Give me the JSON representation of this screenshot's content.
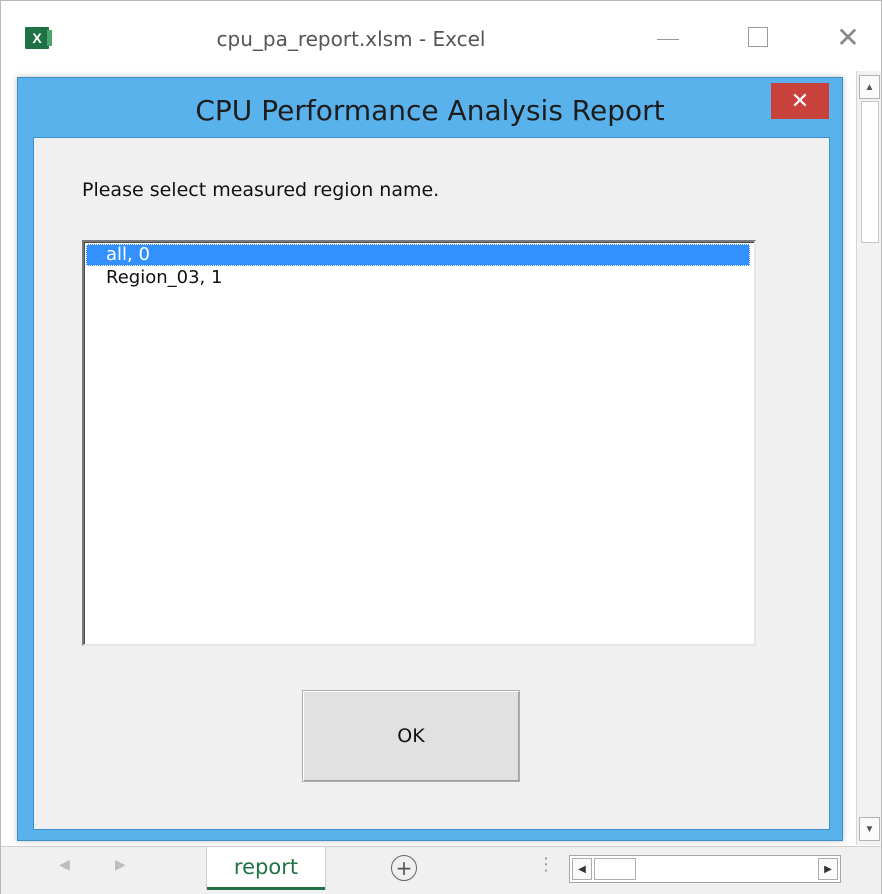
{
  "window": {
    "title": "cpu_pa_report.xlsm - Excel",
    "app_icon_letter": "X",
    "minimize_icon": "minimize-icon",
    "maximize_icon": "maximize-icon",
    "close_glyph": "✕"
  },
  "dialog": {
    "title": "CPU Performance Analysis Report",
    "close_glyph": "✕",
    "prompt": "Please select measured region name.",
    "list_items": [
      {
        "label": "all, 0",
        "selected": true
      },
      {
        "label": "Region_03, 1",
        "selected": false
      }
    ],
    "ok_label": "OK",
    "accent_color": "#5ab2ec",
    "selection_color": "#3391ff",
    "close_color": "#c8413a"
  },
  "sheet_tabs": {
    "active_tab": "report",
    "add_glyph": "+",
    "prev_glyph": "◀",
    "next_glyph": "▶",
    "split_glyph": "⋮",
    "accent_color": "#217346"
  },
  "scrollbars": {
    "up_glyph": "▲",
    "down_glyph": "▼",
    "left_glyph": "◀",
    "right_glyph": "▶"
  }
}
